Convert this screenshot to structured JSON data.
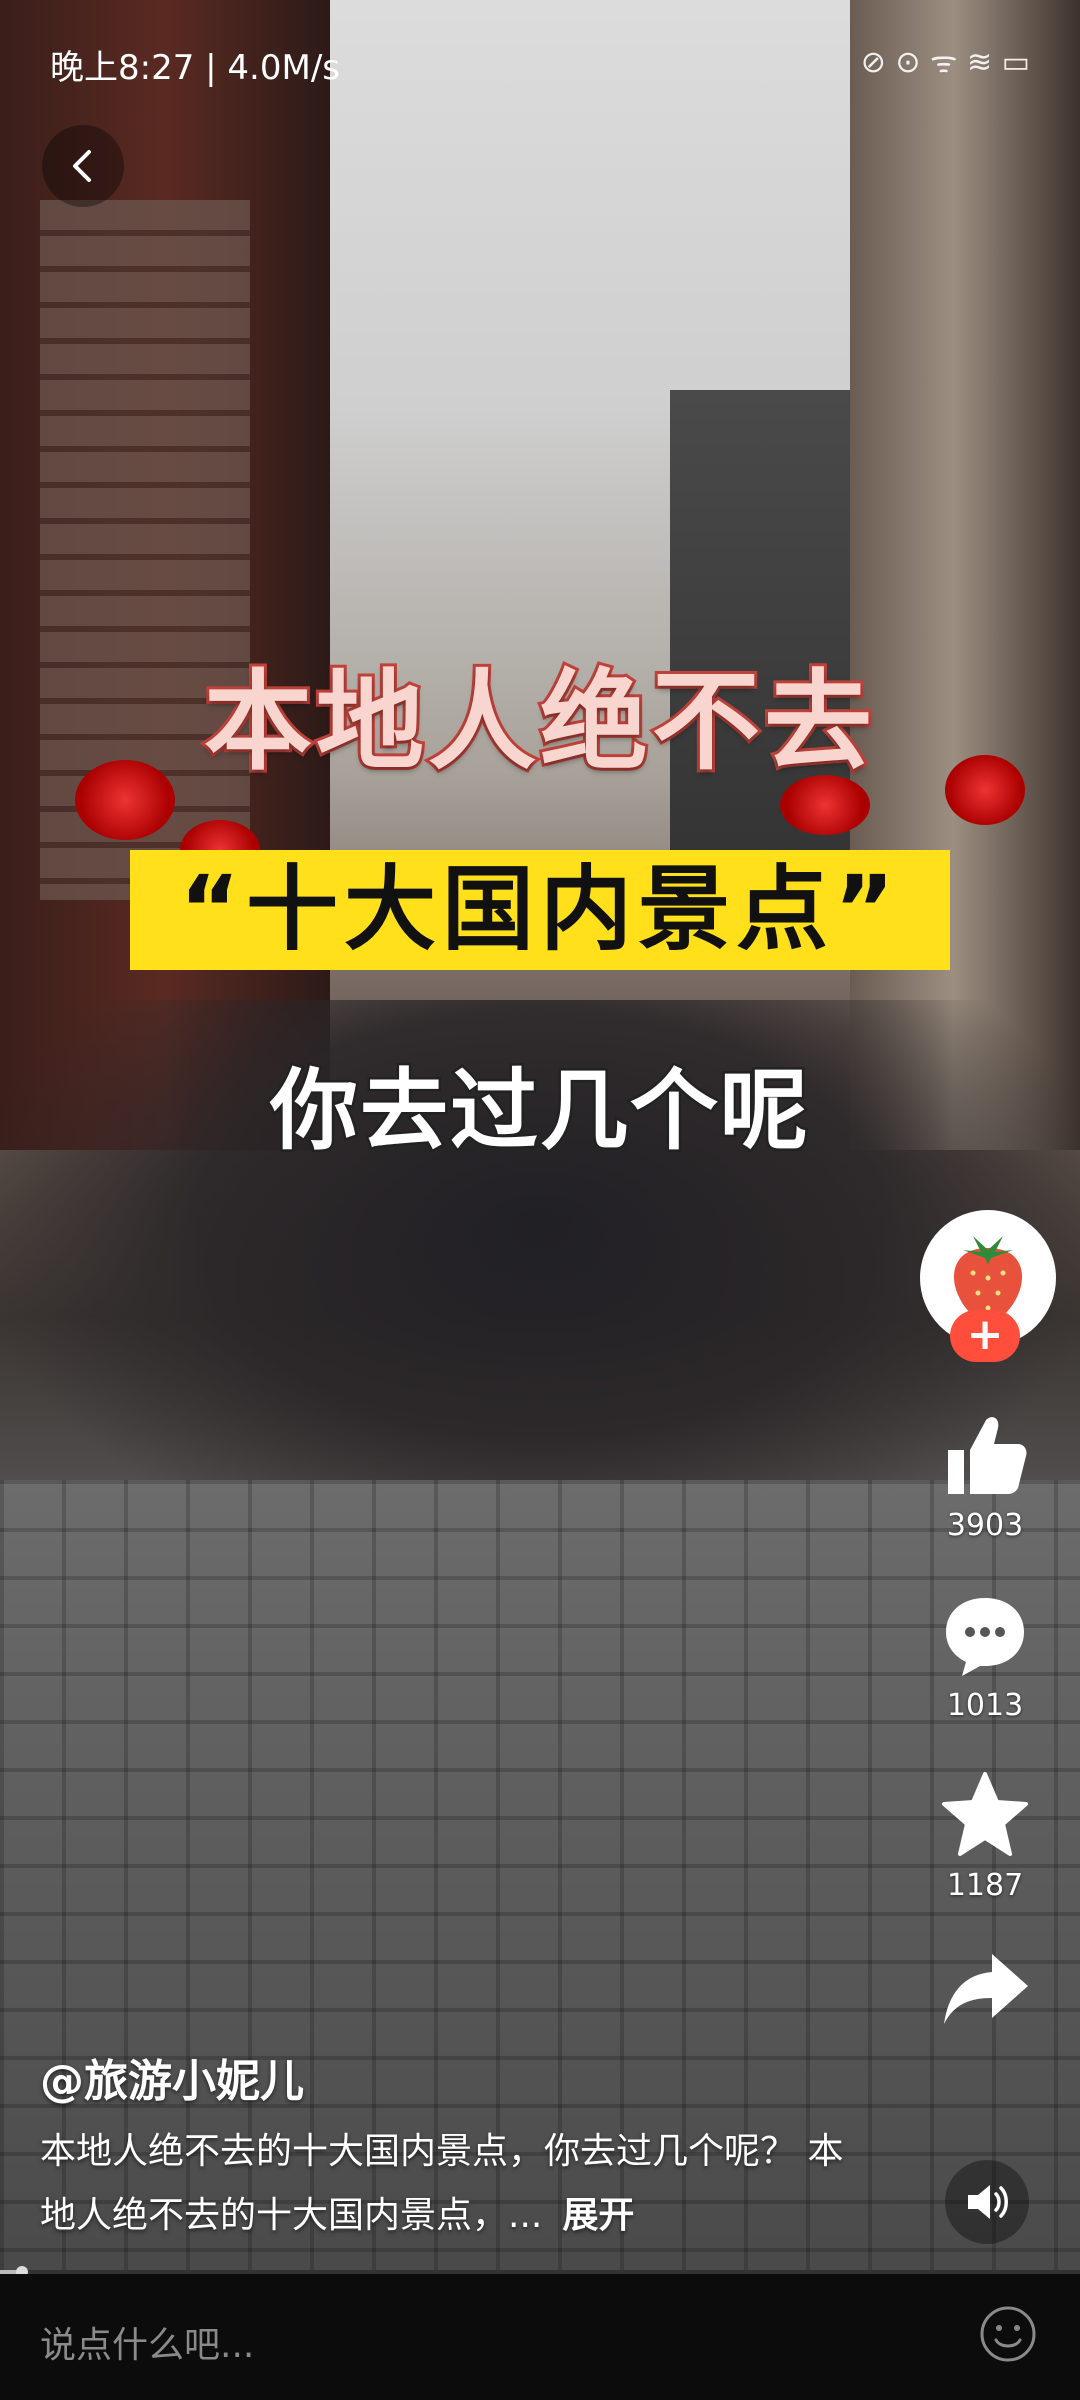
{
  "status_bar": {
    "time_speed": "晚上8:27 | 4.0M/s",
    "indicators": "⊘ ⊙ ᯤ ≋ ▭"
  },
  "overlay": {
    "line1": "本地人绝不去",
    "line2": "“十大国内景点”",
    "line3": "你去过几个呢"
  },
  "rail": {
    "like_count": "3903",
    "comment_count": "1013",
    "favorite_count": "1187"
  },
  "caption": {
    "author": "@旅游小妮儿",
    "description": "本地人绝不去的十大国内景点，你去过几个呢？ 本地人绝不去的十大国内景点，...",
    "expand_label": "展开"
  },
  "comment_bar": {
    "placeholder": "说点什么吧..."
  },
  "progress": {
    "value": 0.02
  },
  "colors": {
    "title_stroke": "#c0423a",
    "title_fill": "#f9d5cf",
    "highlight_bg": "#ffe01a",
    "follow_button": "#ff4e3c"
  },
  "icons": {
    "back": "chevron-left-icon",
    "like": "thumb-up-icon",
    "comment": "chat-bubble-icon",
    "favorite": "star-icon",
    "share": "share-arrow-icon",
    "sound": "speaker-icon",
    "emoji": "smiley-icon",
    "avatar": "strawberry-icon"
  }
}
